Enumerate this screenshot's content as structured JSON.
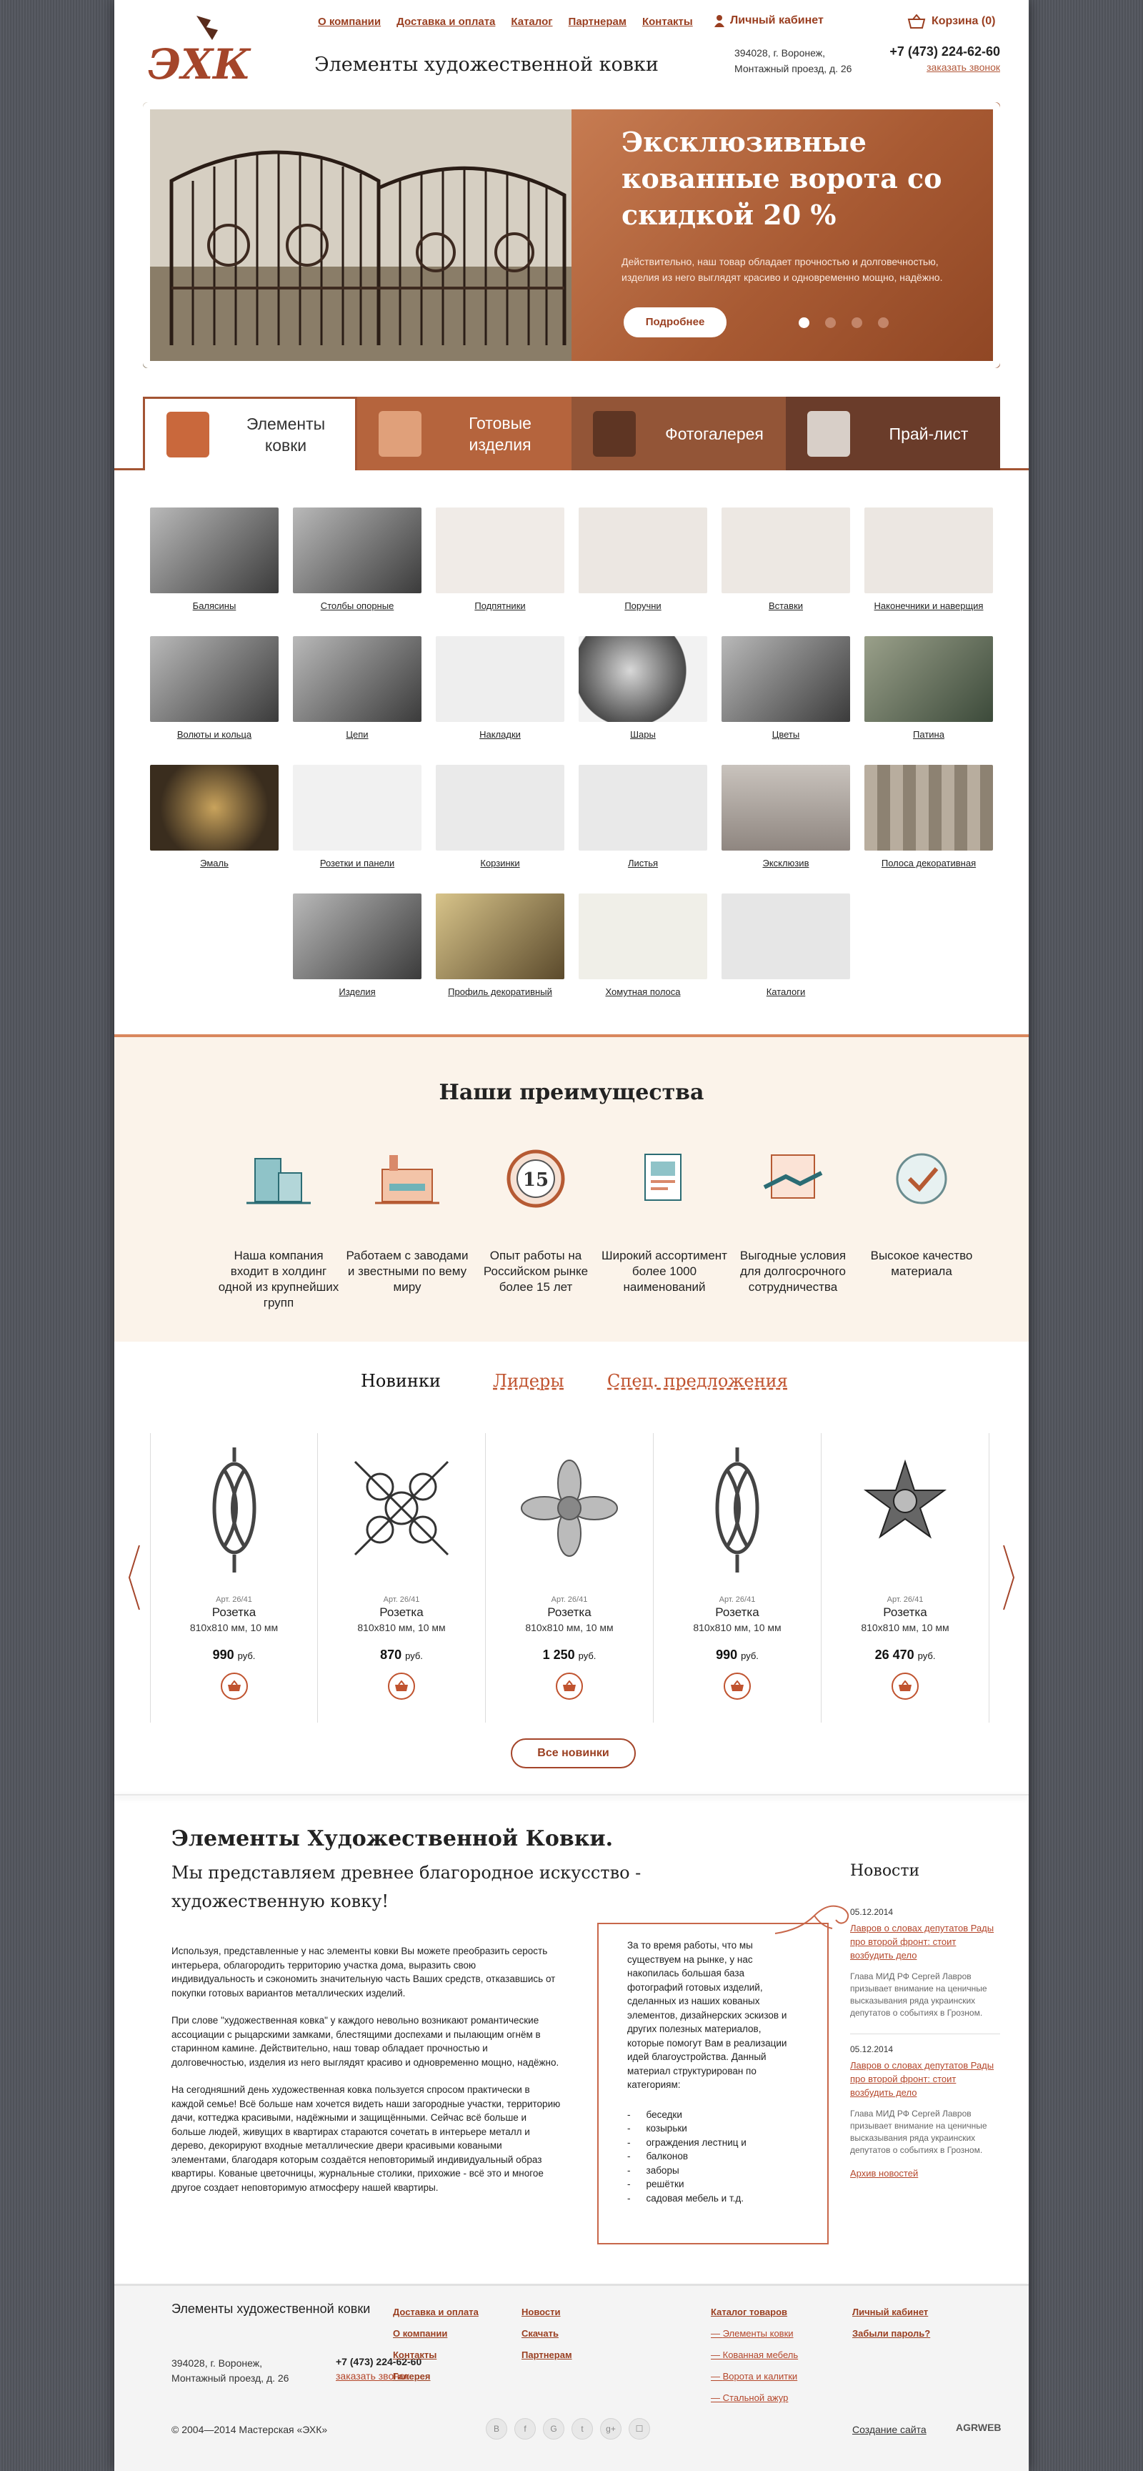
{
  "header": {
    "nav": [
      "О компании",
      "Доставка и оплата",
      "Каталог",
      "Партнерам",
      "Контакты"
    ],
    "cabinet": "Личный кабинет",
    "cart": "Корзина (0)",
    "site_title": "Элементы художественной ковки",
    "address_line1": "394028, г. Воронеж,",
    "address_line2": "Монтажный проезд, д. 26",
    "phone": "+7 (473) 224-62-60",
    "callback": "заказать звонок"
  },
  "slider": {
    "title": "Эксклюзивные кованные ворота со скидкой 20 %",
    "text": "Действительно, наш товар обладает прочностью и долговечностью, изделия из него выглядят красиво и одновременно мощно, надёжно.",
    "button": "Подробнее",
    "active_dot": 1,
    "dots": 4
  },
  "tabs": [
    "Элементы ковки",
    "Готовые изделия",
    "Фотогалерея",
    "Прай-лист"
  ],
  "catalog": [
    "Балясины",
    "Столбы опорные",
    "Подпятники",
    "Поручни",
    "Вставки",
    "Наконечники и наверщия",
    "Волюты и кольца",
    "Цепи",
    "Накладки",
    "Шары",
    "Цветы",
    "Патина",
    "Эмаль",
    "Розетки и панели",
    "Корзинки",
    "Листья",
    "Эксклюзив",
    "Полоса декоративная",
    "Изделия",
    "Профиль декоративный",
    "Хомутная полоса",
    "Каталоги"
  ],
  "advantages": {
    "title": "Наши преимущества",
    "items": [
      "Наша компания входит в холдинг одной из крупнейших групп",
      "Работаем с заводами и звестными по вему миру",
      "Опыт работы на Российском рынке более 15 лет",
      "Широкий ассортимент более 1000 наименований",
      "Выгодные условия для долгосрочного сотрудничества",
      "Высокое качество материала"
    ]
  },
  "products": {
    "tabs": {
      "new": "Новинки",
      "leaders": "Лидеры",
      "special": "Спец. предложения"
    },
    "items": [
      {
        "art": "Арт. 26/41",
        "name": "Розетка",
        "size": "810x810 мм, 10 мм",
        "price": "990",
        "currency": "руб."
      },
      {
        "art": "Арт. 26/41",
        "name": "Розетка",
        "size": "810x810 мм, 10 мм",
        "price": "870",
        "currency": "руб."
      },
      {
        "art": "Арт. 26/41",
        "name": "Розетка",
        "size": "810x810 мм, 10 мм",
        "price": "1 250",
        "currency": "руб."
      },
      {
        "art": "Арт. 26/41",
        "name": "Розетка",
        "size": "810x810 мм, 10 мм",
        "price": "990",
        "currency": "руб."
      },
      {
        "art": "Арт. 26/41",
        "name": "Розетка",
        "size": "810x810 мм, 10 мм",
        "price": "26 470",
        "currency": "руб."
      }
    ],
    "all_button": "Все новинки"
  },
  "about": {
    "title": "Элементы Художественной Ковки.",
    "subtitle": "Мы представляем древнее благородное искусство - художественную ковку!",
    "p1": "Используя, представленные у нас элементы ковки Вы можете преобразить серость интерьера, облагородить территорию участка дома, выразить свою индивидуальность и сэкономить значительную часть Ваших средств, отказавшись от покупки готовых вариантов металлических изделий.",
    "p2": "При слове \"художественная ковка\" у каждого невольно возникают романтические ассоциации с рыцарскими замками, блестящими доспехами и пылающим огнём в старинном камине. Действительно, наш товар обладает прочностью и долговечностью, изделия из него выглядят красиво и одновременно мощно, надёжно.",
    "p3": "На сегодняшний день художественная ковка пользуется спросом практически в каждой семье! Всё больше нам хочется видеть наши загородные участки, территорию дачи, коттеджа красивыми, надёжными и защищёнными. Сейчас всё больше и больше людей, живущих в квартирах стараются сочетать в интерьере металл и дерево, декорируют входные металлические двери красивыми коваными элементами, благодаря которым создаётся неповторимый индивидуальный образ квартиры. Кованые цветочницы, журнальные столики, прихожие - всё это и многое другое создает неповторимую атмосферу нашей квартиры.",
    "quote": "За то время работы, что мы существуем на рынке, у нас накопилась большая база фотографий готовых изделий, сделанных из наших кованых элементов, дизайнерских эскизов и других полезных материалов, которые помогут Вам в реализации идей благоустройства. Данный материал структурирован по категориям:",
    "quote_list": [
      "беседки",
      "козырьки",
      "ограждения лестниц и",
      "балконов",
      "заборы",
      "решётки",
      "садовая мебель и т.д."
    ]
  },
  "news": {
    "title": "Новости",
    "items": [
      {
        "date": "05.12.2014",
        "title": "Лавров о словах депутатов Рады про второй фронт: стоит возбудить дело",
        "body": "Глава МИД РФ Сергей Лавров призывает внимание на ценичные высказывания ряда украинских депутатов о событиях в Грозном."
      },
      {
        "date": "05.12.2014",
        "title": "Лавров о словах депутатов Рады про второй фронт: стоит возбудить дело",
        "body": "Глава МИД РФ Сергей Лавров призывает внимание на ценичные высказывания ряда украинских депутатов о событиях в Грозном."
      }
    ],
    "archive": "Архив новостей"
  },
  "footer": {
    "title": "Элементы художественной ковки",
    "address_line1": "394028, г. Воронеж,",
    "address_line2": "Монтажный проезд, д. 26",
    "phone": "+7 (473) 224-62-60",
    "callback": "заказать звонок",
    "col1": [
      "Доставка и оплата",
      "О компании",
      "Контакты",
      "Галерея"
    ],
    "col2": [
      "Новости",
      "Скачать",
      "Партнерам"
    ],
    "col3_title": "Каталог товаров",
    "col3": [
      "Элементы ковки",
      "Кованная мебель",
      "Ворота и калитки",
      "Стальной ажур"
    ],
    "col4": [
      "Личный кабинет",
      "Забыли пароль?"
    ],
    "copyright": "© 2004—2014 Мастерская «ЭХК»",
    "social": [
      "B",
      "f",
      "G",
      "t",
      "g+",
      "☐"
    ],
    "made": "Создание сайта",
    "agr": "AGRWEB"
  }
}
